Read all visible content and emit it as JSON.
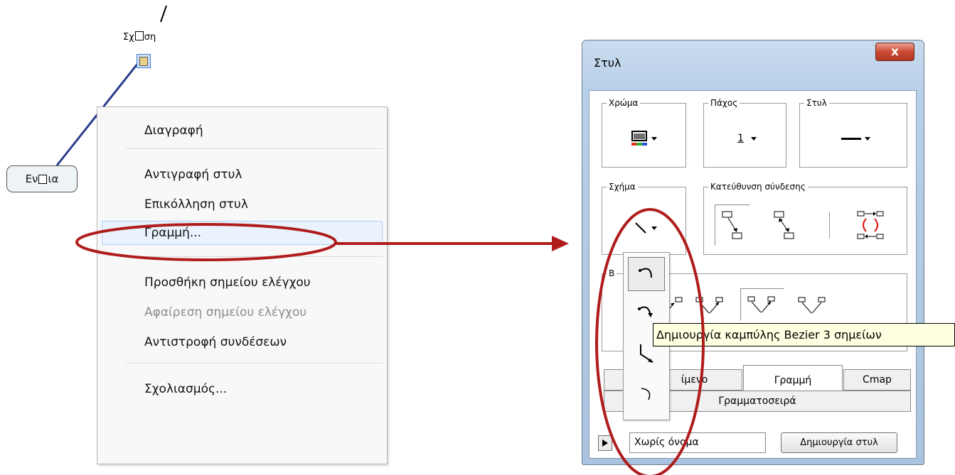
{
  "canvas": {
    "link_label_prefix": "Σχ",
    "link_label_suffix": "ση",
    "concept_prefix": "Εν",
    "concept_suffix": "ια"
  },
  "context_menu": {
    "items": [
      {
        "label": "Διαγραφή"
      },
      {
        "label": "Αντιγραφή στυλ"
      },
      {
        "label": "Επικόλληση στυλ"
      },
      {
        "label": "Γραμμή..."
      },
      {
        "label": "Προσθήκη σημείου ελέγχου"
      },
      {
        "label": "Αφαίρεση σημείου ελέγχου"
      },
      {
        "label": "Αντιστροφή συνδέσεων"
      },
      {
        "label": "Σχολιασμός..."
      }
    ]
  },
  "dialog": {
    "title": "Στυλ",
    "close_label": "x",
    "groups": {
      "color": "Χρώμα",
      "thickness": "Πάχος",
      "style": "Στυλ",
      "shape": "Σχήμα",
      "direction": "Κατεύθυνση σύνδεσης",
      "arrows_partial": "Β"
    },
    "thickness_value": "1",
    "tabs": [
      "ίμενο",
      "Γραμμή",
      "Cmap"
    ],
    "font_tab": "Γραμματοσειρά",
    "style_name": "Χωρίς όνομα",
    "create_button": "Δημιουργία στυλ"
  },
  "tooltip": "Δημιουργία καμπύλης Bezier 3 σημείων",
  "colors": {
    "annotation": "#b01c1c",
    "link_line": "#2b3a8c",
    "window_frame": "#b9d0ea",
    "close_button": "#c94a30"
  }
}
